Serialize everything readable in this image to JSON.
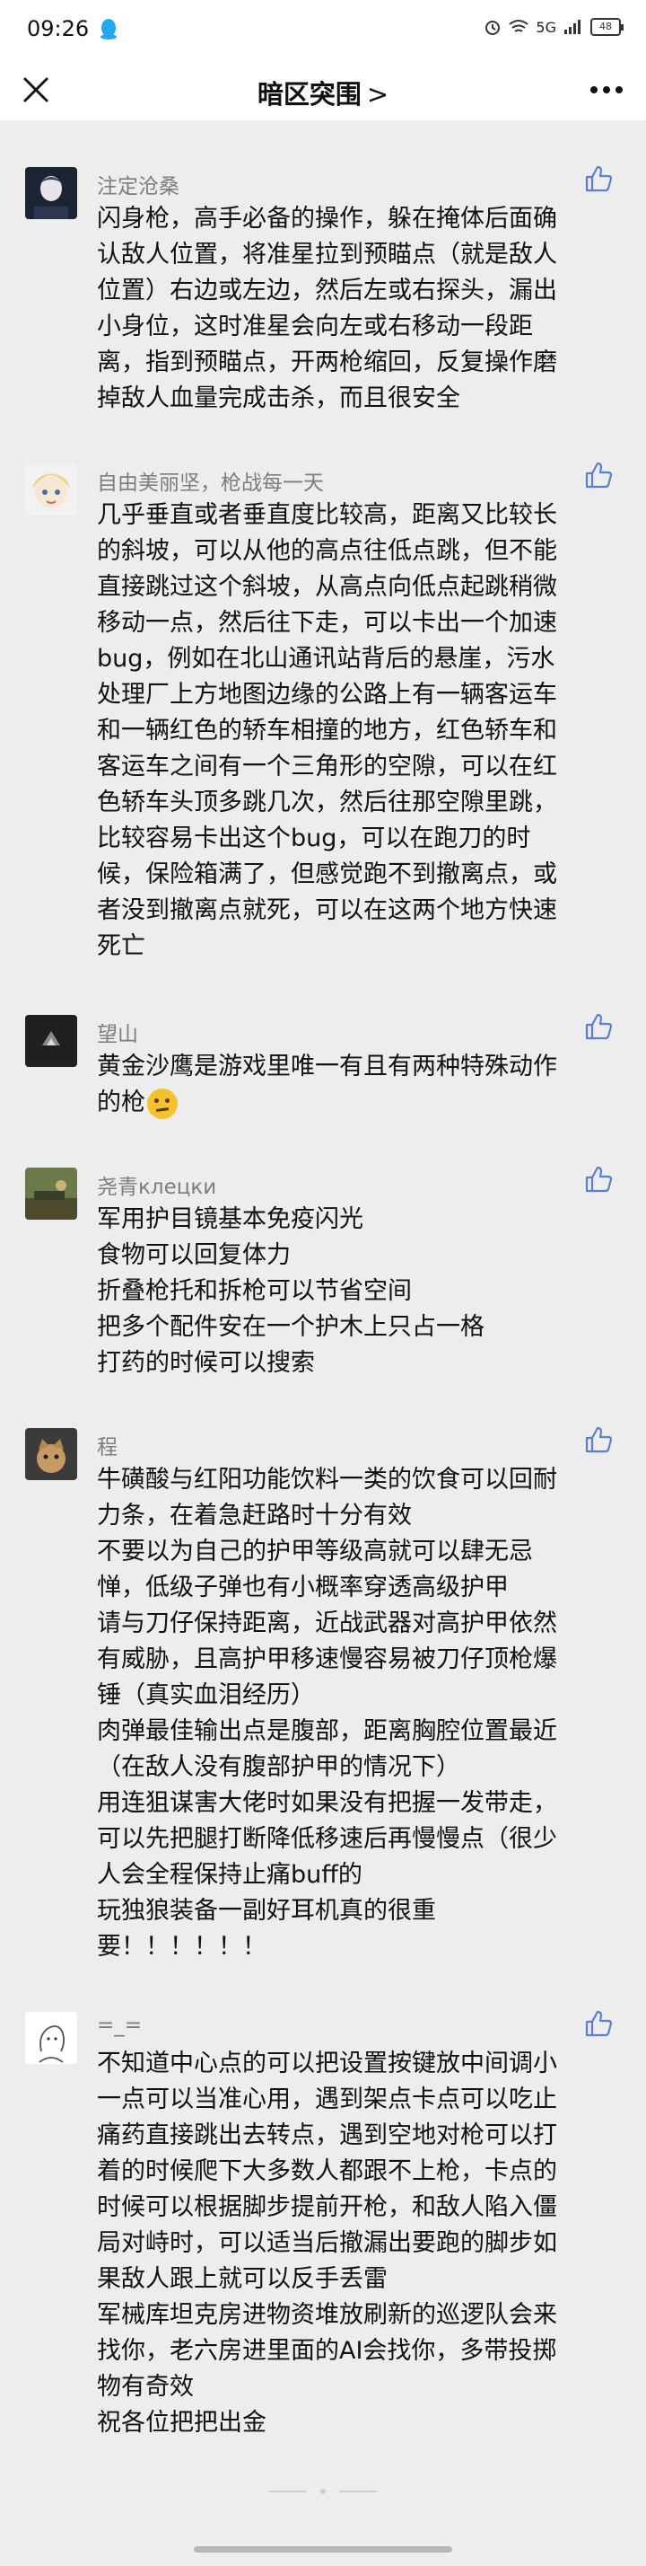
{
  "status_bar": {
    "time": "09:26",
    "icons": [
      "alarm-icon",
      "wifi-icon",
      "signal-icon"
    ],
    "signal_label": "5G",
    "battery": "48"
  },
  "nav": {
    "title": "暗区突围",
    "chevron": ">",
    "close_icon": "close-icon",
    "more_icon": "more-icon"
  },
  "comments": [
    {
      "name": "注定沧桑",
      "lines": [
        "闪身枪，高手必备的操作，躲在掩体后面确",
        "认敌人位置，将准星拉到预瞄点（就是敌人",
        "位置）右边或左边，然后左或右探头，漏出",
        "小身位，这时准星会向左或右移动一段距",
        "离，指到预瞄点，开两枪缩回，反复操作磨",
        "掉敌人血量完成击杀，而且很安全"
      ]
    },
    {
      "name": "自由美丽坚，枪战每一天",
      "lines": [
        "几乎垂直或者垂直度比较高，距离又比较长",
        "的斜坡，可以从他的高点往低点跳，但不能",
        "直接跳过这个斜坡，从高点向低点起跳稍微",
        "移动一点，然后往下走，可以卡出一个加速",
        "bug，例如在北山通讯站背后的悬崖，污水",
        "处理厂上方地图边缘的公路上有一辆客运车",
        "和一辆红色的轿车相撞的地方，红色轿车和",
        "客运车之间有一个三角形的空隙，可以在红",
        "色轿车头顶多跳几次，然后往那空隙里跳，",
        "比较容易卡出这个bug，可以在跑刀的时",
        "候，保险箱满了，但感觉跑不到撤离点，或",
        "者没到撤离点就死，可以在这两个地方快速",
        "死亡"
      ]
    },
    {
      "name": "望山",
      "lines": [
        "黄金沙鹰是游戏里唯一有且有两种特殊动作",
        "的枪"
      ]
    },
    {
      "name": "尧青клецки",
      "lines": [
        "军用护目镜基本免疫闪光",
        "食物可以回复体力",
        "折叠枪托和拆枪可以节省空间",
        "把多个配件安在一个护木上只占一格",
        "打药的时候可以搜索"
      ]
    },
    {
      "name": "程",
      "lines": [
        "牛磺酸与红阳功能饮料一类的饮食可以回耐",
        "力条，在着急赶路时十分有效",
        "不要以为自己的护甲等级高就可以肆无忌",
        "惮，低级子弹也有小概率穿透高级护甲",
        "请与刀仔保持距离，近战武器对高护甲依然",
        "有威胁，且高护甲移速慢容易被刀仔顶枪爆",
        "锤（真实血泪经历）",
        "肉弹最佳输出点是腹部，距离胸腔位置最近",
        "（在敌人没有腹部护甲的情况下）",
        "用连狙谋害大佬时如果没有把握一发带走，",
        "可以先把腿打断降低移速后再慢慢点（很少",
        "人会全程保持止痛buff的",
        "玩独狼装备一副好耳机真的很重",
        "要！！！！！！"
      ]
    },
    {
      "name": "=_=",
      "lines": [
        "不知道中心点的可以把设置按键放中间调小",
        "一点可以当准心用，遇到架点卡点可以吃止",
        "痛药直接跳出去转点，遇到空地对枪可以打",
        "着的时候爬下大多数人都跟不上枪，卡点的",
        "时候可以根据脚步提前开枪，和敌人陷入僵",
        "局对峙时，可以适当后撤漏出要跑的脚步如",
        "果敌人跟上就可以反手丢雷",
        "军械库坦克房进物资堆放刷新的巡逻队会来",
        "找你，老六房进里面的AI会找你，多带投掷",
        "物有奇效",
        "祝各位把把出金"
      ]
    }
  ]
}
